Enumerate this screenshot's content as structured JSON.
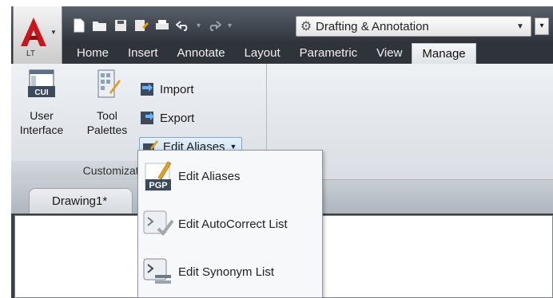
{
  "app": {
    "badge": "LT",
    "workspace": "Drafting & Annotation"
  },
  "quick_access": {
    "icons": [
      "new-icon",
      "open-icon",
      "save-icon",
      "save-as-icon",
      "plot-icon",
      "undo-icon",
      "redo-icon"
    ]
  },
  "tabs": [
    "Home",
    "Insert",
    "Annotate",
    "Layout",
    "Parametric",
    "View",
    "Manage"
  ],
  "active_tab": "Manage",
  "ribbon": {
    "user_interface": {
      "line1": "User",
      "line2": "Interface"
    },
    "tool_palettes": {
      "line1": "Tool",
      "line2": "Palettes"
    },
    "import": "Import",
    "export": "Export",
    "edit_aliases": "Edit Aliases",
    "panel_title": "Customization",
    "cui_label": "CUI"
  },
  "document": {
    "tab": "Drawing1*"
  },
  "menu": {
    "items": [
      {
        "label": "Edit Aliases",
        "icon_text": "PGP"
      },
      {
        "label": "Edit AutoCorrect List"
      },
      {
        "label": "Edit Synonym List"
      }
    ]
  },
  "colors": {
    "title_bar": "#3a3f46",
    "ribbon_bg": "#e6eaee",
    "highlight": "#c7def3",
    "logo_red": "#c8161d"
  }
}
